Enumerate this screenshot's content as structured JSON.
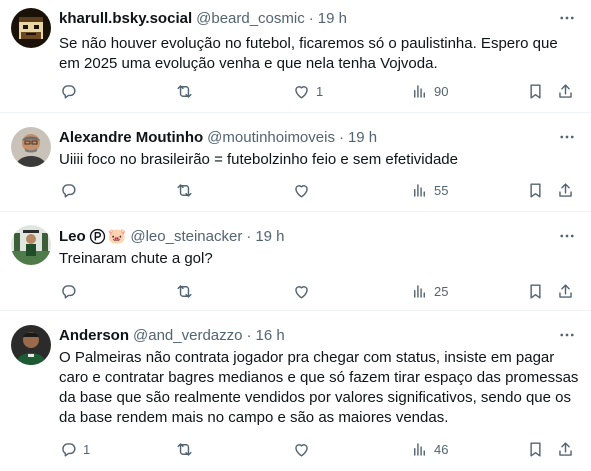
{
  "tweets": [
    {
      "name": "kharull.bsky.social",
      "handle": "@beard_cosmic",
      "time": "19 h",
      "text": "Se não houver evolução no futebol, ficaremos só o paulistinha. Espero que em 2025 uma evolução venha e que nela tenha Vojvoda.",
      "replies": "",
      "reposts": "",
      "likes": "1",
      "views": "90"
    },
    {
      "name": "Alexandre Moutinho",
      "handle": "@moutinhoimoveis",
      "time": "19 h",
      "text": "Uiiii foco no brasileirão = futebolzinho feio e sem efetividade",
      "replies": "",
      "reposts": "",
      "likes": "",
      "views": "55"
    },
    {
      "name": "Leo",
      "handle": "@leo_steinacker",
      "time": "19 h",
      "text": "Treinaram chute a gol?",
      "replies": "",
      "reposts": "",
      "likes": "",
      "views": "25",
      "badge_emoji": "🐷"
    },
    {
      "name": "Anderson",
      "handle": "@and_verdazzo",
      "time": "16 h",
      "text": "O Palmeiras não contrata jogador pra chegar com status, insiste em pagar caro e contratar bagres medianos e que só fazem tirar espaço das promessas da base que são realmente vendidos por valores significativos, sendo que os da base rendem mais no campo e são as maiores vendas.",
      "replies": "1",
      "reposts": "",
      "likes": "",
      "views": "46"
    }
  ],
  "separator": "·",
  "icons": [
    "more-icon",
    "reply-icon",
    "repost-icon",
    "like-icon",
    "views-icon",
    "bookmark-icon",
    "share-icon"
  ],
  "colors": {
    "text": "#0f1419",
    "secondary": "#536471",
    "border": "#eff3f4"
  }
}
